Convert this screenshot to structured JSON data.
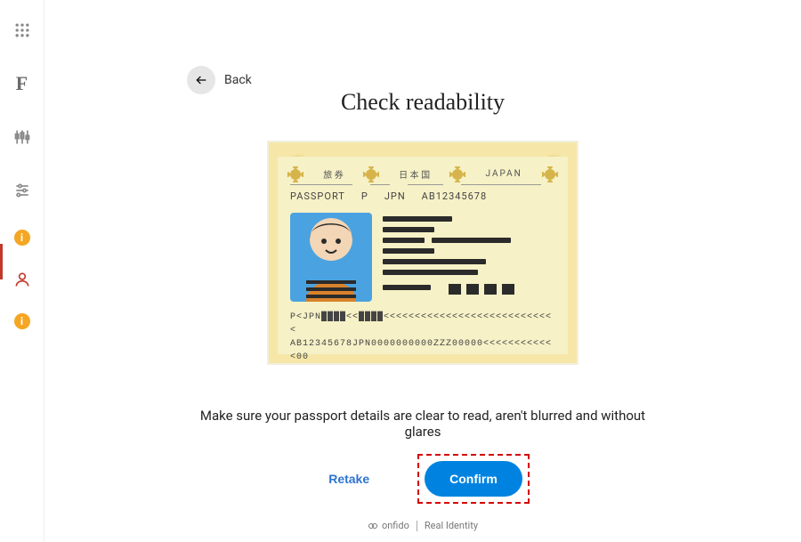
{
  "nav": {
    "back": "Back"
  },
  "page": {
    "title": "Check readability",
    "instruction": "Make sure your passport details are clear to read, aren't blurred and without glares"
  },
  "passport": {
    "top_jp1": "旅 券",
    "top_jp2": "日 本 国",
    "top_en": "JAPAN",
    "label_passport": "PASSPORT",
    "label_p": "P",
    "label_jpn": "JPN",
    "doc_number": "AB12345678",
    "mrz1": "P<JPN████<<████<<<<<<<<<<<<<<<<<<<<<<<<<<<<",
    "mrz2": "AB12345678JPN0000000000ZZZ00000<<<<<<<<<<<<00"
  },
  "actions": {
    "retake": "Retake",
    "confirm": "Confirm"
  },
  "footer": {
    "brand": "onfido",
    "tagline": "Real Identity"
  },
  "sidebar": {
    "items": [
      {
        "name": "apps"
      },
      {
        "name": "brand"
      },
      {
        "name": "candles"
      },
      {
        "name": "filters"
      },
      {
        "name": "info1"
      },
      {
        "name": "profile"
      },
      {
        "name": "info2"
      }
    ]
  }
}
